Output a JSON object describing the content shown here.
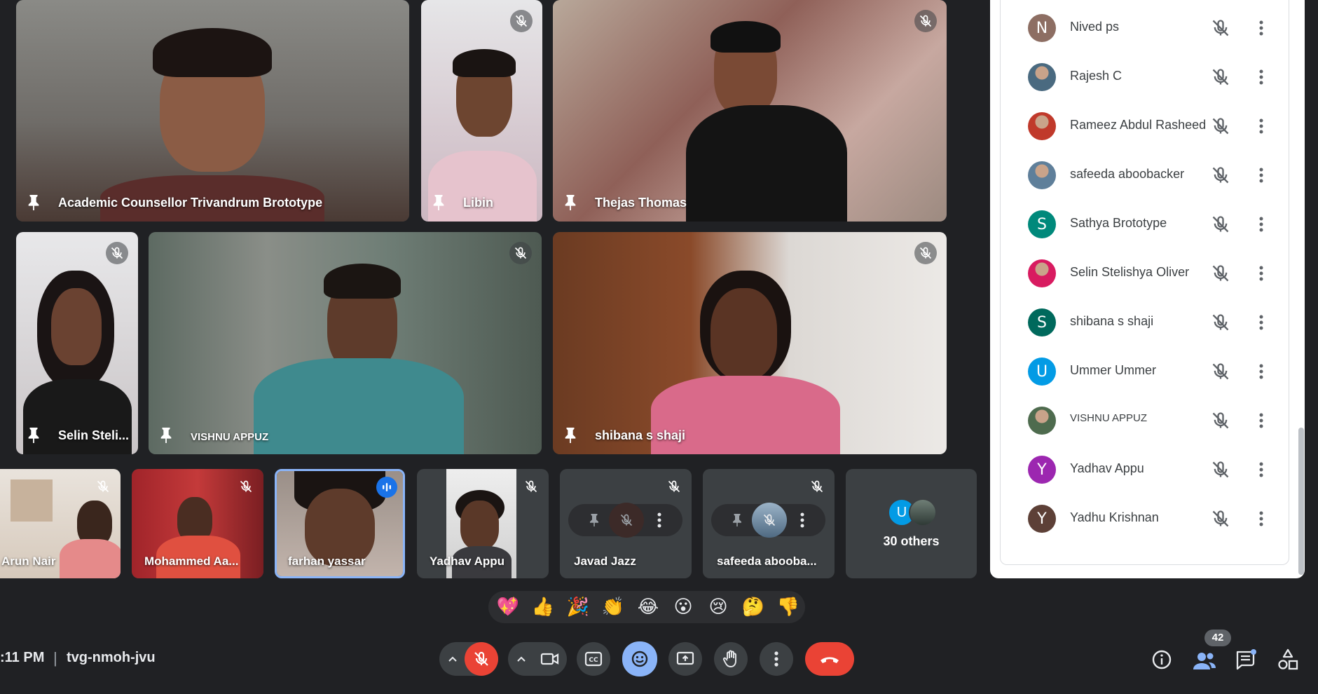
{
  "tiles": [
    {
      "name": "Academic Counsellor Trivandrum Brototype",
      "muted": false
    },
    {
      "name": "Libin",
      "muted": true
    },
    {
      "name": "Thejas Thomas",
      "muted": true
    },
    {
      "name": "Selin Steli...",
      "muted": true
    },
    {
      "name": "VISHNU APPUZ",
      "muted": true
    },
    {
      "name": "shibana s shaji",
      "muted": true
    }
  ],
  "filmstrip": [
    {
      "name": "Arun Nair",
      "muted": true
    },
    {
      "name": "Mohammed Aa...",
      "muted": true
    },
    {
      "name": "farhan yassar",
      "speaking": true
    },
    {
      "name": "Yadhav Appu",
      "muted": true
    },
    {
      "name": "Javad Jazz",
      "muted": true
    },
    {
      "name": "safeeda abooba...",
      "muted": true
    }
  ],
  "others": {
    "avatar_letter": "U",
    "label": "30 others"
  },
  "participants": [
    {
      "name": "Nived ps",
      "avatar": "N",
      "avatar_color": "#8d6e63"
    },
    {
      "name": "Rajesh C",
      "avatar": "photo",
      "avatar_color": "#4a6a80"
    },
    {
      "name": "Rameez Abdul Rasheed",
      "avatar": "photo",
      "avatar_color": "#c0392b"
    },
    {
      "name": "safeeda aboobacker",
      "avatar": "photo",
      "avatar_color": "#5f7f9a"
    },
    {
      "name": "Sathya Brototype",
      "avatar": "S",
      "avatar_color": "#00897b"
    },
    {
      "name": "Selin Stelishya Oliver",
      "avatar": "photo",
      "avatar_color": "#d81b60"
    },
    {
      "name": "shibana s shaji",
      "avatar": "S",
      "avatar_color": "#00695c"
    },
    {
      "name": "Ummer Ummer",
      "avatar": "U",
      "avatar_color": "#039be5"
    },
    {
      "name": "VISHNU APPUZ",
      "avatar": "photo",
      "avatar_color": "#4e6b4e"
    },
    {
      "name": "Yadhav Appu",
      "avatar": "Y",
      "avatar_color": "#9c27b0"
    },
    {
      "name": "Yadhu Krishnan",
      "avatar": "Y",
      "avatar_color": "#5d4037"
    }
  ],
  "reactions": [
    "💖",
    "👍",
    "🎉",
    "👏",
    "😂",
    "😮",
    "😢",
    "🤔",
    "👎"
  ],
  "meeting": {
    "time": ":11 PM",
    "separator": "|",
    "code": "tvg-nmoh-jvu"
  },
  "participant_count": "42",
  "colors": {
    "background": "#202124",
    "end_call": "#ea4335",
    "accent": "#8ab4f8",
    "speaking": "#1a73e8"
  }
}
